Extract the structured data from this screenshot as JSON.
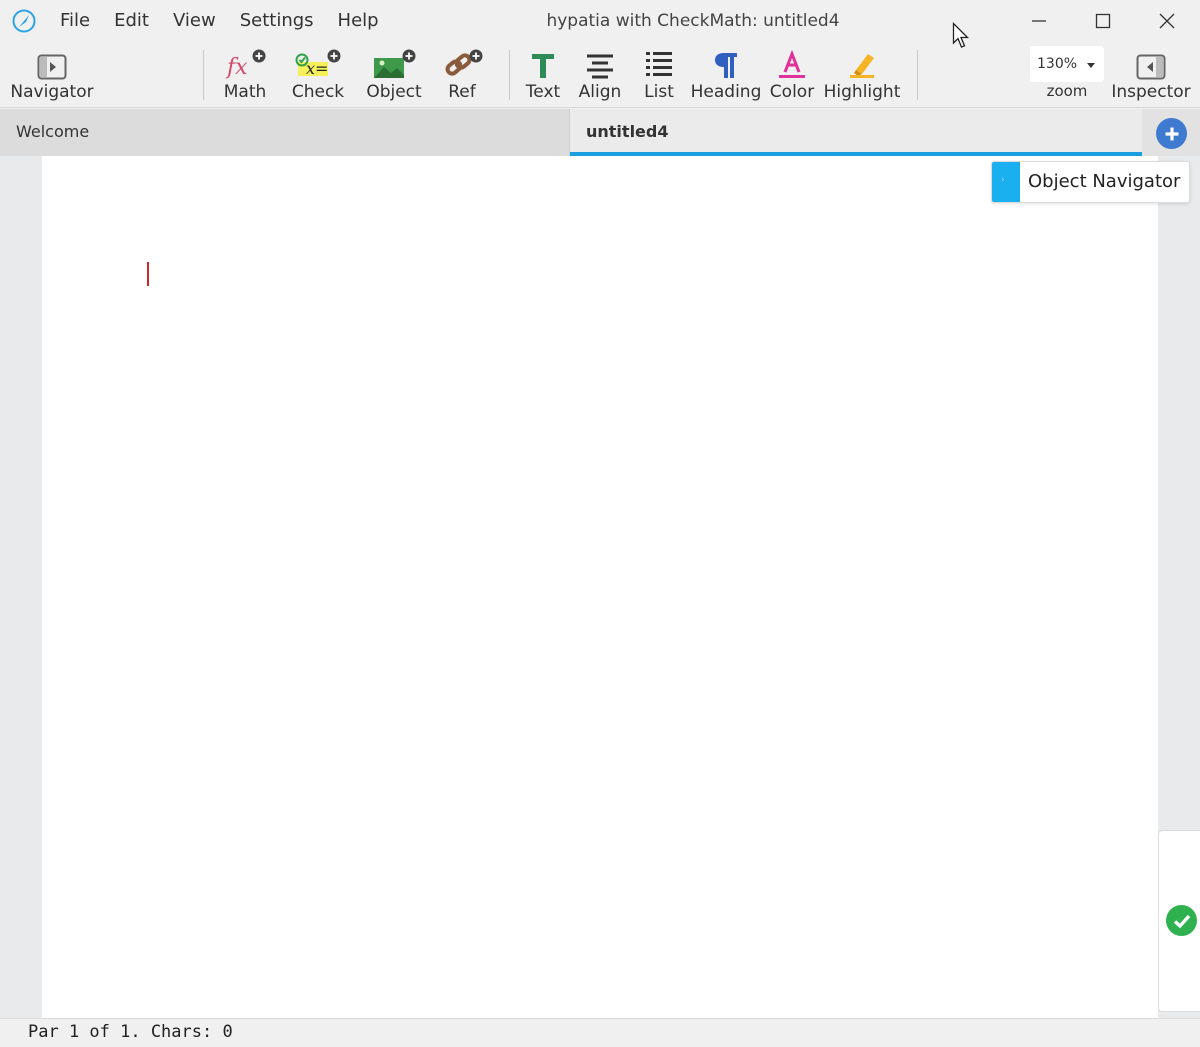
{
  "window": {
    "title": "hypatia with CheckMath: untitled4"
  },
  "menu": [
    "File",
    "Edit",
    "View",
    "Settings",
    "Help"
  ],
  "toolbar": {
    "navigator": "Navigator",
    "math": "Math",
    "check": "Check",
    "object": "Object",
    "ref": "Ref",
    "text": "Text",
    "align": "Align",
    "list": "List",
    "heading": "Heading",
    "color": "Color",
    "highlight": "Highlight",
    "zoom_value": "130%",
    "zoom_label": "zoom",
    "inspector": "Inspector"
  },
  "tabs": [
    {
      "label": "Welcome",
      "active": false
    },
    {
      "label": "untitled4",
      "active": true
    }
  ],
  "object_navigator": {
    "label": "Object Navigator"
  },
  "status": {
    "text": "Par 1 of 1. Chars: 0"
  },
  "colors": {
    "accent": "#1a9ee0",
    "add_tab": "#3d7ad0",
    "check_ok": "#2fb14f",
    "caret": "#d0262a"
  }
}
